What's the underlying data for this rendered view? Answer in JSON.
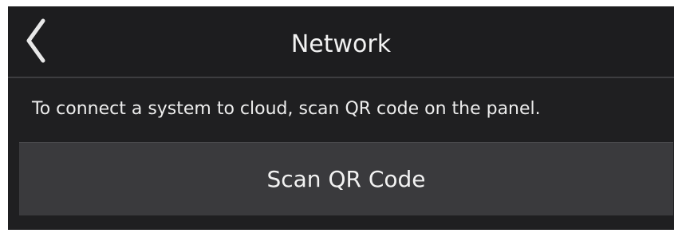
{
  "header": {
    "title": "Network",
    "back_icon": "chevron-left-icon"
  },
  "main": {
    "description": "To connect a system to cloud, scan QR code on the panel.",
    "scan_button_label": "Scan QR Code"
  },
  "colors": {
    "background": "#1f1f21",
    "button": "#3a3a3d",
    "text": "#f2f2f2",
    "divider": "#3d3d40"
  }
}
